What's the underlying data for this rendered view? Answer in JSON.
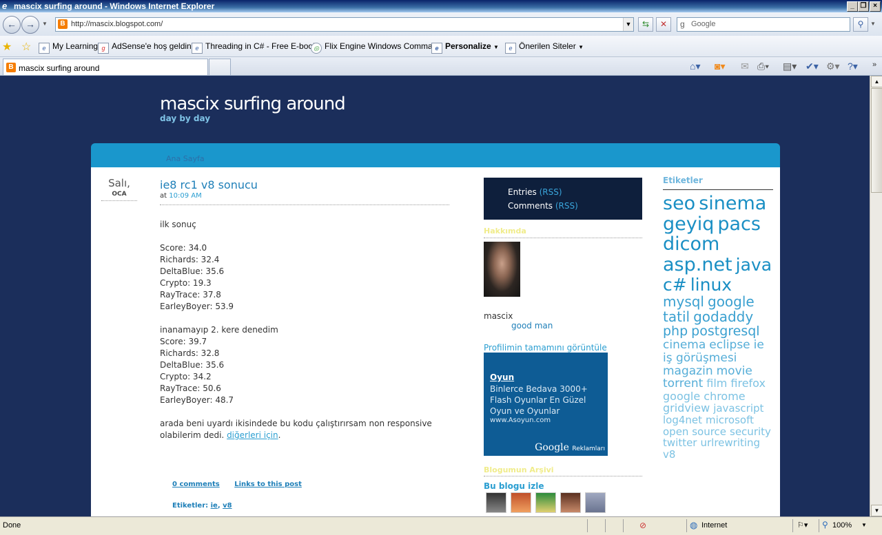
{
  "window": {
    "title": "mascix surfing around - Windows Internet Explorer"
  },
  "address": {
    "url": "http://mascix.blogspot.com/",
    "search_placeholder": "Google"
  },
  "favorites": [
    {
      "label": "My Learning"
    },
    {
      "label": "AdSense'e hoş geldiniz"
    },
    {
      "label": "Threading in C# - Free E-book"
    },
    {
      "label": "Flix Engine Windows Comma..."
    },
    {
      "label": "Personalize"
    },
    {
      "label": "Önerilen Siteler"
    }
  ],
  "tab": {
    "label": "mascix surfing around"
  },
  "blog": {
    "title": "mascix surfing around",
    "description": "day by day",
    "nav_home": "Ana Sayfa"
  },
  "post": {
    "day": "Salı,",
    "month": "OCA",
    "title": "ie8 rc1 v8 sonucu",
    "meta_prefix": "at",
    "time": "10:09 AM",
    "intro": "ilk sonuç",
    "run1": [
      "Score: 34.0",
      "Richards: 32.4",
      "DeltaBlue: 35.6",
      "Crypto: 19.3",
      "RayTrace: 37.8",
      "EarleyBoyer: 53.9"
    ],
    "retry": "inanamayıp 2. kere denedim",
    "run2": [
      "Score: 39.7",
      "Richards: 32.8",
      "DeltaBlue: 35.6",
      "Crypto: 34.2",
      "RayTrace: 50.6",
      "EarleyBoyer: 48.7"
    ],
    "closing": "arada beni uyardı ikisindede bu kodu çalıştırırsam non responsive olabilerim dedi.",
    "closing_link": "diğerleri için",
    "comments": "0 comments",
    "links": "Links to this post",
    "labels_prefix": "Etiketler:",
    "label1": "ie",
    "label2": "v8"
  },
  "sidebar": {
    "entries": "Entries",
    "comments": "Comments",
    "rss": "(RSS)",
    "about_head": "Hakkımda",
    "profile_name": "mascix",
    "profile_desc": "good man",
    "profile_link": "Profilimin tamamını görüntüle",
    "archive_head": "Blogumun Arşivi",
    "follow_head": "Bu blogu izle"
  },
  "ad": {
    "title": "Oyun",
    "body": "Binlerce Bedava 3000+ Flash Oyunlar En Güzel Oyun ve Oyunlar",
    "url": "www.Asoyun.com",
    "brand": "Google",
    "brand_suffix": "Reklamları"
  },
  "labels": {
    "head": "Etiketler",
    "tags": [
      {
        "text": "seo",
        "size": 27,
        "color": "#1a8fc4"
      },
      {
        "text": "sinema",
        "size": 27,
        "color": "#1a8fc4"
      },
      {
        "text": "geyiq",
        "size": 27,
        "color": "#1a8fc4"
      },
      {
        "text": "pacs",
        "size": 27,
        "color": "#1a8fc4"
      },
      {
        "text": "dicom",
        "size": 27,
        "color": "#1a8fc4"
      },
      {
        "text": "asp.net",
        "size": 27,
        "color": "#1a8fc4"
      },
      {
        "text": "java",
        "size": 25,
        "color": "#1a8fc4"
      },
      {
        "text": "c#",
        "size": 25,
        "color": "#1a8fc4"
      },
      {
        "text": "linux",
        "size": 25,
        "color": "#1a8fc4"
      },
      {
        "text": "mysql",
        "size": 20,
        "color": "#3aa0d0"
      },
      {
        "text": "google",
        "size": 20,
        "color": "#3aa0d0"
      },
      {
        "text": "tatil",
        "size": 20,
        "color": "#3aa0d0"
      },
      {
        "text": "godaddy",
        "size": 20,
        "color": "#3aa0d0"
      },
      {
        "text": "php",
        "size": 19,
        "color": "#3aa0d0"
      },
      {
        "text": "postgresql",
        "size": 19,
        "color": "#3aa0d0"
      },
      {
        "text": "cinema",
        "size": 17,
        "color": "#56aed8"
      },
      {
        "text": "eclipse",
        "size": 17,
        "color": "#56aed8"
      },
      {
        "text": "ie",
        "size": 17,
        "color": "#56aed8"
      },
      {
        "text": "iş görüşmesi",
        "size": 17,
        "color": "#56aed8"
      },
      {
        "text": "magazin",
        "size": 17,
        "color": "#56aed8"
      },
      {
        "text": "movie",
        "size": 17,
        "color": "#56aed8"
      },
      {
        "text": "torrent",
        "size": 17,
        "color": "#56aed8"
      },
      {
        "text": "film",
        "size": 16,
        "color": "#7cc2e3"
      },
      {
        "text": "firefox",
        "size": 16,
        "color": "#7cc2e3"
      },
      {
        "text": "google chrome",
        "size": 16,
        "color": "#7cc2e3"
      },
      {
        "text": "gridview",
        "size": 16,
        "color": "#7cc2e3"
      },
      {
        "text": "javascript",
        "size": 15,
        "color": "#7cc2e3"
      },
      {
        "text": "log4net",
        "size": 15,
        "color": "#7cc2e3"
      },
      {
        "text": "microsoft",
        "size": 15,
        "color": "#7cc2e3"
      },
      {
        "text": "open source",
        "size": 15,
        "color": "#7cc2e3"
      },
      {
        "text": "security",
        "size": 15,
        "color": "#7cc2e3"
      },
      {
        "text": "twitter",
        "size": 15,
        "color": "#7cc2e3"
      },
      {
        "text": "urlrewriting",
        "size": 15,
        "color": "#7cc2e3"
      },
      {
        "text": "v8",
        "size": 15,
        "color": "#7cc2e3"
      }
    ]
  },
  "status": {
    "text": "Done",
    "zone": "Internet",
    "zoom": "100%"
  }
}
